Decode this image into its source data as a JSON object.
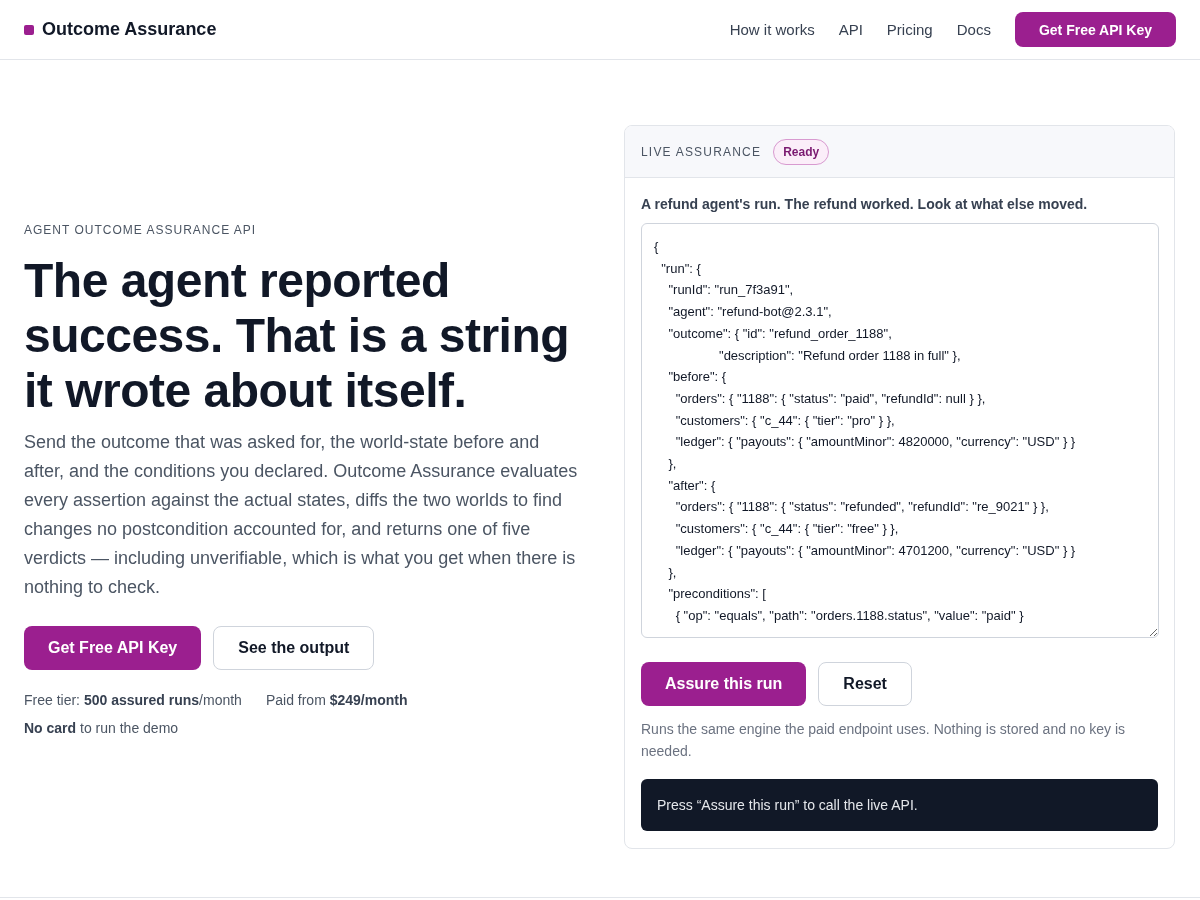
{
  "header": {
    "brand": "Outcome Assurance",
    "nav": [
      "How it works",
      "API",
      "Pricing",
      "Docs"
    ],
    "cta": "Get Free API Key"
  },
  "hero": {
    "eyebrow": "AGENT OUTCOME ASSURANCE API",
    "title": "The agent reported success. That is a string it wrote about itself.",
    "body": "Send the outcome that was asked for, the world-state before and after, and the conditions you declared. Outcome Assurance evaluates every assertion against the actual states, diffs the two worlds to find changes no postcondition accounted for, and returns one of five verdicts — including unverifiable, which is what you get when there is nothing to check.",
    "buttons": [
      {
        "label": "Get Free API Key",
        "kind": "primary"
      },
      {
        "label": "See the output",
        "kind": "secondary"
      }
    ],
    "notes": [
      "Free tier: **500 assured runs**/month",
      "Paid from **$249/month**",
      "**No card** to run the demo"
    ]
  },
  "panel": {
    "title": "LIVE ASSURANCE",
    "badge": "Ready",
    "caption": "A refund agent's run. The refund worked. Look at what else moved.",
    "code_lines": [
      "{",
      "  \"run\": {",
      "    \"runId\": \"run_7f3a91\",",
      "    \"agent\": \"refund-bot@2.3.1\",",
      "    \"outcome\": { \"id\": \"refund_order_1188\",",
      "                  \"description\": \"Refund order 1188 in full\" },",
      "    \"before\": {",
      "      \"orders\": { \"1188\": { \"status\": \"paid\", \"refundId\": null } },",
      "      \"customers\": { \"c_44\": { \"tier\": \"pro\" } },",
      "      \"ledger\": { \"payouts\": { \"amountMinor\": 4820000, \"currency\": \"USD\" } }",
      "    },",
      "    \"after\": {",
      "      \"orders\": { \"1188\": { \"status\": \"refunded\", \"refundId\": \"re_9021\" } },",
      "      \"customers\": { \"c_44\": { \"tier\": \"free\" } },",
      "      \"ledger\": { \"payouts\": { \"amountMinor\": 4701200, \"currency\": \"USD\" } }",
      "    },",
      "    \"preconditions\": [",
      "      { \"op\": \"equals\", \"path\": \"orders.1188.status\", \"value\": \"paid\" }"
    ],
    "buttons": [
      {
        "label": "Assure this run",
        "kind": "primary"
      },
      {
        "label": "Reset",
        "kind": "secondary"
      }
    ],
    "hint": "Runs the same engine the paid endpoint uses. Nothing is stored and no key is needed.",
    "output": "Press “Assure this run” to call the live API."
  }
}
